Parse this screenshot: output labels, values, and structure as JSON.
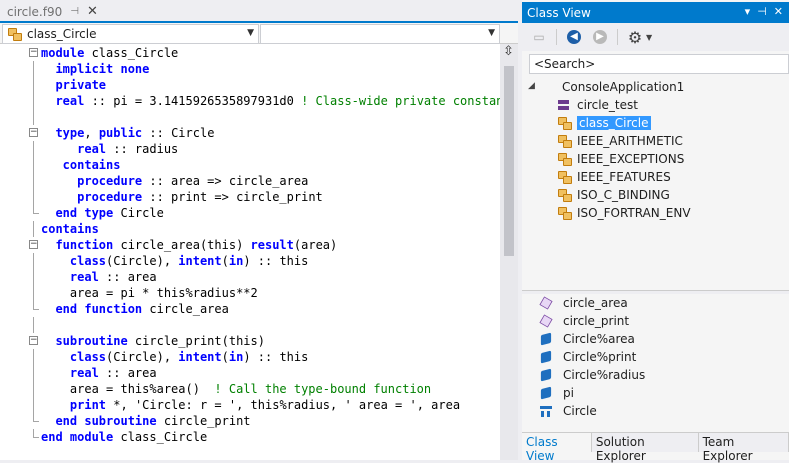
{
  "editor": {
    "tab_label": "circle.f90",
    "pin_glyph": "⊣",
    "close_glyph": "✕",
    "scope_combo": "class_Circle",
    "member_combo": "",
    "lines": [
      [
        {
          "t": "module",
          "c": "kw"
        },
        {
          "t": " class_Circle",
          "c": ""
        }
      ],
      [
        {
          "t": "  implicit none",
          "c": "kw"
        }
      ],
      [
        {
          "t": "  private",
          "c": "kw"
        }
      ],
      [
        {
          "t": "  real",
          "c": "kw"
        },
        {
          "t": " :: pi = 3.1415926535897931d0 ",
          "c": ""
        },
        {
          "t": "! Class-wide private constant",
          "c": "cm"
        }
      ],
      [],
      [
        {
          "t": "  type",
          "c": "kw"
        },
        {
          "t": ", ",
          "c": ""
        },
        {
          "t": "public",
          "c": "kw"
        },
        {
          "t": " :: Circle",
          "c": ""
        }
      ],
      [
        {
          "t": "     real",
          "c": "kw"
        },
        {
          "t": " :: radius",
          "c": ""
        }
      ],
      [
        {
          "t": "   contains",
          "c": "kw"
        }
      ],
      [
        {
          "t": "     procedure",
          "c": "kw"
        },
        {
          "t": " :: area => circle_area",
          "c": ""
        }
      ],
      [
        {
          "t": "     procedure",
          "c": "kw"
        },
        {
          "t": " :: print => circle_print",
          "c": ""
        }
      ],
      [
        {
          "t": "  end type",
          "c": "kw"
        },
        {
          "t": " Circle",
          "c": ""
        }
      ],
      [
        {
          "t": "contains",
          "c": "kw"
        }
      ],
      [
        {
          "t": "  function",
          "c": "kw"
        },
        {
          "t": " circle_area(this) ",
          "c": ""
        },
        {
          "t": "result",
          "c": "kw"
        },
        {
          "t": "(area)",
          "c": ""
        }
      ],
      [
        {
          "t": "    class",
          "c": "kw"
        },
        {
          "t": "(Circle), ",
          "c": ""
        },
        {
          "t": "intent",
          "c": "kw"
        },
        {
          "t": "(",
          "c": ""
        },
        {
          "t": "in",
          "c": "kw"
        },
        {
          "t": ") :: this",
          "c": ""
        }
      ],
      [
        {
          "t": "    real",
          "c": "kw"
        },
        {
          "t": " :: area",
          "c": ""
        }
      ],
      [
        {
          "t": "    area = pi * this%radius**2",
          "c": ""
        }
      ],
      [
        {
          "t": "  end function",
          "c": "kw"
        },
        {
          "t": " circle_area",
          "c": ""
        }
      ],
      [],
      [
        {
          "t": "  subroutine",
          "c": "kw"
        },
        {
          "t": " circle_print(this)",
          "c": ""
        }
      ],
      [
        {
          "t": "    class",
          "c": "kw"
        },
        {
          "t": "(Circle), ",
          "c": ""
        },
        {
          "t": "intent",
          "c": "kw"
        },
        {
          "t": "(",
          "c": ""
        },
        {
          "t": "in",
          "c": "kw"
        },
        {
          "t": ") :: this",
          "c": ""
        }
      ],
      [
        {
          "t": "    real",
          "c": "kw"
        },
        {
          "t": " :: area",
          "c": ""
        }
      ],
      [
        {
          "t": "    area = this%area()  ",
          "c": ""
        },
        {
          "t": "! Call the type-bound function",
          "c": "cm"
        }
      ],
      [
        {
          "t": "    print",
          "c": "kw"
        },
        {
          "t": " *, ",
          "c": ""
        },
        {
          "t": "'Circle: r = '",
          "c": ""
        },
        {
          "t": ", this%radius, ",
          "c": ""
        },
        {
          "t": "' area = '",
          "c": ""
        },
        {
          "t": ", area",
          "c": ""
        }
      ],
      [
        {
          "t": "  end subroutine",
          "c": "kw"
        },
        {
          "t": " circle_print",
          "c": ""
        }
      ],
      [
        {
          "t": "end module",
          "c": "kw"
        },
        {
          "t": " class_Circle",
          "c": ""
        }
      ]
    ]
  },
  "class_view": {
    "title": "Class View",
    "search_placeholder": "<Search>",
    "tree": [
      {
        "label": "ConsoleApplication1",
        "icon": "expand-triangle",
        "level": 0,
        "selected": false
      },
      {
        "label": "circle_test",
        "icon": "program-icon",
        "level": 1,
        "selected": false
      },
      {
        "label": "class_Circle",
        "icon": "module-icon",
        "level": 1,
        "selected": true
      },
      {
        "label": "IEEE_ARITHMETIC",
        "icon": "module-icon",
        "level": 1,
        "selected": false
      },
      {
        "label": "IEEE_EXCEPTIONS",
        "icon": "module-icon",
        "level": 1,
        "selected": false
      },
      {
        "label": "IEEE_FEATURES",
        "icon": "module-icon",
        "level": 1,
        "selected": false
      },
      {
        "label": "ISO_C_BINDING",
        "icon": "module-icon",
        "level": 1,
        "selected": false
      },
      {
        "label": "ISO_FORTRAN_ENV",
        "icon": "module-icon",
        "level": 1,
        "selected": false
      }
    ],
    "members": [
      {
        "label": "circle_area",
        "icon": "method-icon"
      },
      {
        "label": "circle_print",
        "icon": "method-icon"
      },
      {
        "label": "Circle%area",
        "icon": "field-icon"
      },
      {
        "label": "Circle%print",
        "icon": "field-icon"
      },
      {
        "label": "Circle%radius",
        "icon": "field-icon"
      },
      {
        "label": "pi",
        "icon": "field-icon"
      },
      {
        "label": "Circle",
        "icon": "type-icon"
      }
    ],
    "bottom_tabs": [
      {
        "label": "Class View",
        "active": true
      },
      {
        "label": "Solution Explorer",
        "active": false
      },
      {
        "label": "Team Explorer",
        "active": false
      }
    ]
  },
  "colors": {
    "accent": "#007acc",
    "keyword": "#0000ff",
    "comment": "#008000",
    "selection": "#3399ff"
  }
}
